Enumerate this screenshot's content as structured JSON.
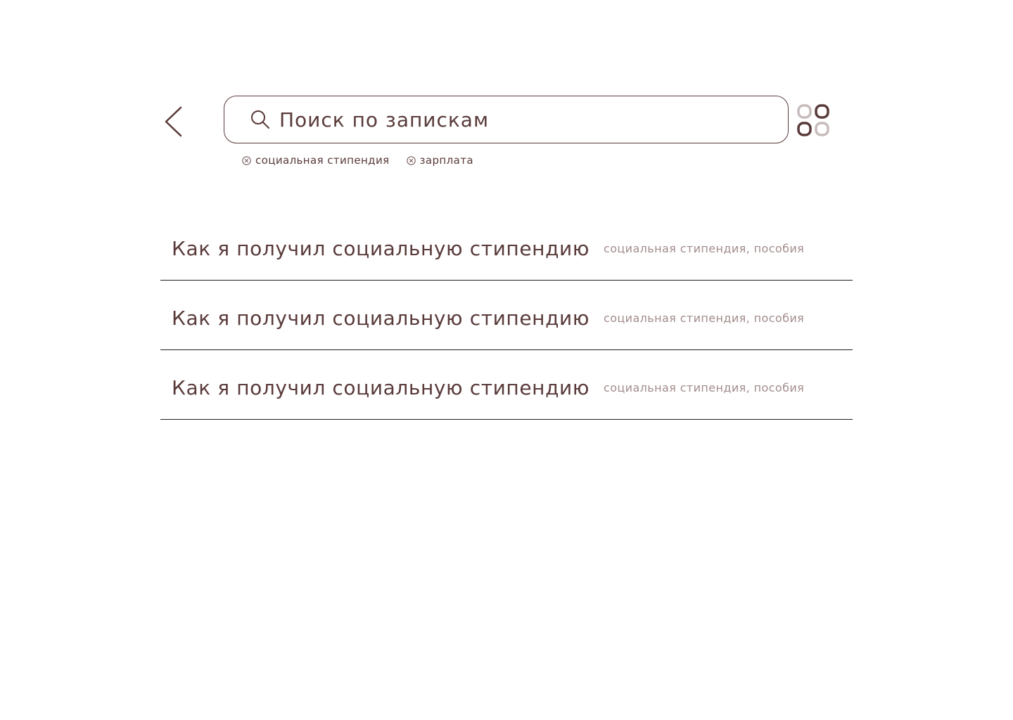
{
  "header": {
    "back_icon": "chevron-left-icon",
    "search": {
      "placeholder": "Поиск по запискам",
      "value": "",
      "icon": "search-icon"
    },
    "view_toggle_icon": "grid-icon"
  },
  "filters": [
    {
      "label": "социальная стипендия",
      "icon": "close-circle-icon"
    },
    {
      "label": "зарплата",
      "icon": "close-circle-icon"
    }
  ],
  "results": [
    {
      "title": "Как я получил социальную стипендию",
      "tags": "социальная стипендия, пособия"
    },
    {
      "title": "Как я получил социальную стипендию",
      "tags": "социальная стипендия, пособия"
    },
    {
      "title": "Как я получил социальную стипендию",
      "tags": "социальная стипендия, пособия"
    }
  ],
  "colors": {
    "primary": "#5a3a3a",
    "muted": "#a38c8c",
    "icon_light": "#c7bcbc",
    "divider": "#1e1e1e",
    "background": "#ffffff"
  }
}
